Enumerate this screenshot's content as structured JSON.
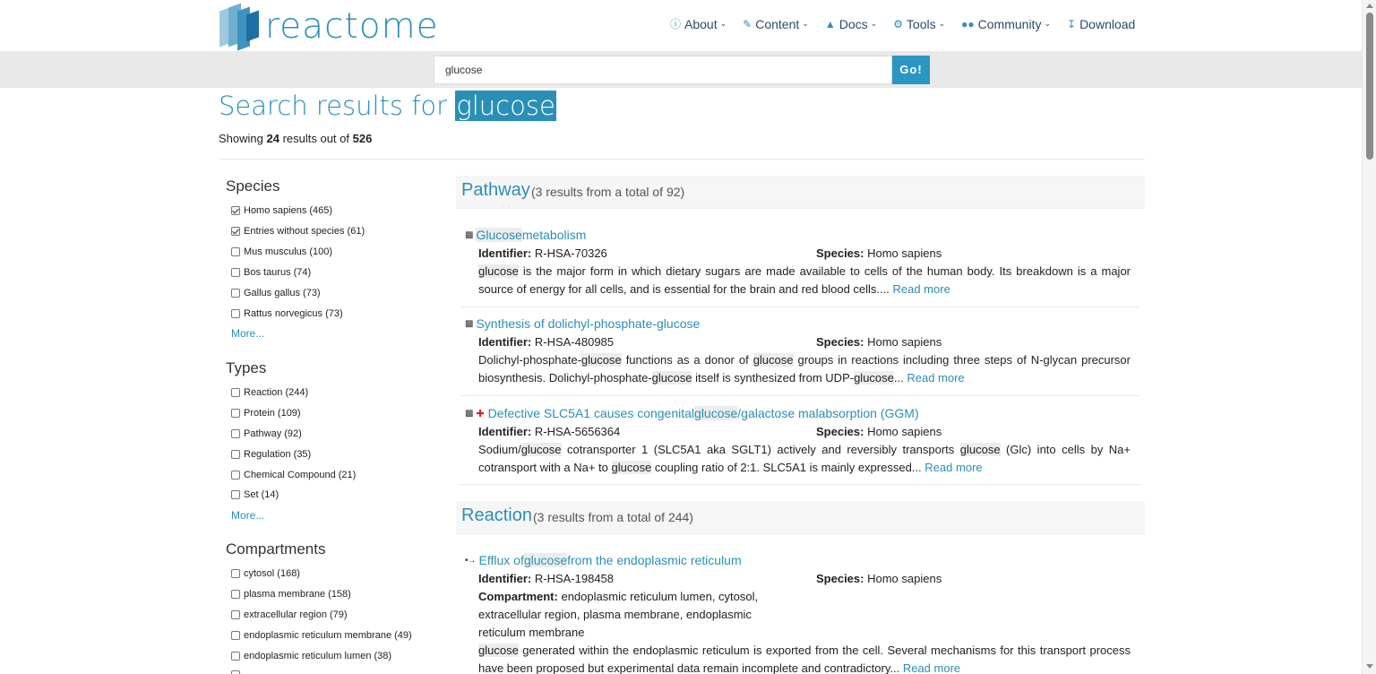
{
  "logo": {
    "text": "reactome"
  },
  "nav": [
    {
      "label": "About",
      "icon": "info-circle-icon",
      "glyph": "ⓘ"
    },
    {
      "label": "Content",
      "icon": "edit-icon",
      "glyph": "✎"
    },
    {
      "label": "Docs",
      "icon": "graduation-cap-icon",
      "glyph": "🎓"
    },
    {
      "label": "Tools",
      "icon": "cogs-icon",
      "glyph": "⚙"
    },
    {
      "label": "Community",
      "icon": "users-icon",
      "glyph": "👥"
    },
    {
      "label": "Download",
      "icon": "download-icon",
      "glyph": "⭳"
    }
  ],
  "search": {
    "value": "glucose",
    "go_label": "Go!"
  },
  "title": {
    "prefix": "Search results for ",
    "query": "glucose"
  },
  "showing": {
    "prefix": "Showing ",
    "count": "24",
    "middle": " results out of ",
    "total": "526"
  },
  "facets": {
    "species": {
      "title": "Species",
      "items": [
        {
          "label": "Homo sapiens (465)",
          "checked": true
        },
        {
          "label": "Entries without species (61)",
          "checked": true
        },
        {
          "label": "Mus musculus (100)",
          "checked": false
        },
        {
          "label": "Bos taurus (74)",
          "checked": false
        },
        {
          "label": "Gallus gallus (73)",
          "checked": false
        },
        {
          "label": "Rattus norvegicus (73)",
          "checked": false
        }
      ],
      "more": "More..."
    },
    "types": {
      "title": "Types",
      "items": [
        {
          "label": "Reaction (244)",
          "checked": false
        },
        {
          "label": "Protein (109)",
          "checked": false
        },
        {
          "label": "Pathway (92)",
          "checked": false
        },
        {
          "label": "Regulation (35)",
          "checked": false
        },
        {
          "label": "Chemical Compound (21)",
          "checked": false
        },
        {
          "label": "Set (14)",
          "checked": false
        }
      ],
      "more": "More..."
    },
    "compartments": {
      "title": "Compartments",
      "items": [
        {
          "label": "cytosol (168)",
          "checked": false
        },
        {
          "label": "plasma membrane (158)",
          "checked": false
        },
        {
          "label": "extracellular region (79)",
          "checked": false
        },
        {
          "label": "endoplasmic reticulum membrane (49)",
          "checked": false
        },
        {
          "label": "endoplasmic reticulum lumen (38)",
          "checked": false
        }
      ]
    }
  },
  "groups": {
    "pathway": {
      "name": "Pathway",
      "count": "(3 results from a total of 92)"
    },
    "reaction": {
      "name": "Reaction",
      "count": "(3 results from a total of 244)"
    }
  },
  "labels": {
    "identifier": "Identifier:",
    "species": "Species:",
    "compartment": "Compartment:",
    "read_more": "Read more"
  },
  "results": [
    {
      "title_parts": [
        "",
        "Glucose",
        " metabolism"
      ],
      "identifier": "R-HSA-70326",
      "species": "Homo sapiens",
      "desc_parts": [
        "",
        "glucose",
        " is the major form in which dietary sugars are made available to cells of the human body. Its breakdown is a major source of energy for all cells, and is essential for the brain and red blood cells.... "
      ]
    },
    {
      "title_parts": [
        "Synthesis of dolichyl-phosphate-glucose"
      ],
      "identifier": "R-HSA-480985",
      "species": "Homo sapiens",
      "desc_parts": [
        "Dolichyl-phosphate-",
        "glucose",
        " functions as a donor of ",
        "glucose",
        " groups in reactions including three steps of N-glycan precursor biosynthesis. Dolichyl-phosphate-",
        "glucose",
        " itself is synthesized from UDP-",
        "glucose",
        "... "
      ]
    },
    {
      "title_parts": [
        "Defective SLC5A1 causes congenital ",
        "glucose",
        "/galactose malabsorption (GGM)"
      ],
      "identifier": "R-HSA-5656364",
      "species": "Homo sapiens",
      "desc_parts": [
        "Sodium/",
        "glucose",
        " cotransporter 1 (SLC5A1 aka SGLT1) actively and reversibly transports ",
        "glucose",
        " (Glc) into cells by Na+ cotransport with a Na+ to ",
        "glucose",
        " coupling ratio of 2:1. SLC5A1 is mainly expressed... "
      ]
    },
    {
      "title_parts": [
        "Efflux of ",
        "glucose",
        " from the endoplasmic reticulum"
      ],
      "identifier": "R-HSA-198458",
      "species": "Homo sapiens",
      "compartment": "endoplasmic reticulum lumen, cytosol, extracellular region, plasma membrane, endoplasmic reticulum membrane",
      "desc_parts": [
        "",
        "glucose",
        " generated within the endoplasmic reticulum is exported from the cell. Several mechanisms for this transport process have been proposed but experimental data remain incomplete and contradictory... "
      ]
    }
  ],
  "colors": {
    "accent": "#2a8fb7",
    "button": "#2a96c2",
    "band": "#e9e9e9",
    "disease": "#dd2222"
  }
}
